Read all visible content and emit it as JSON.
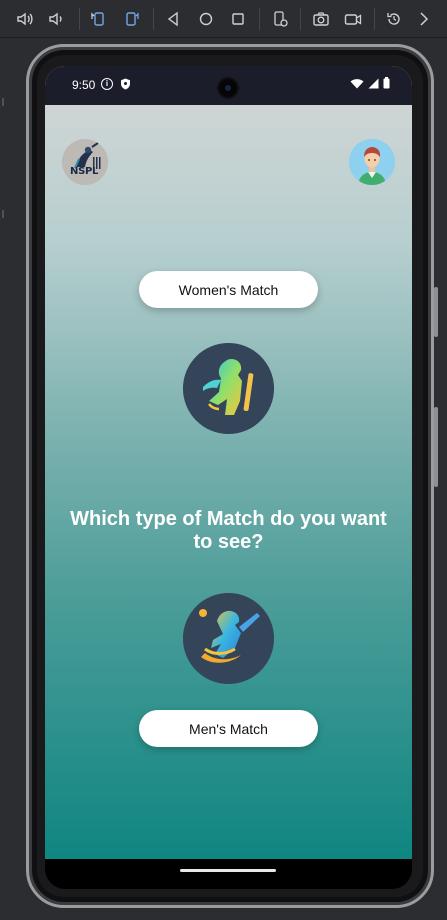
{
  "status_bar": {
    "time": "9:50",
    "info_glyph": "i"
  },
  "app": {
    "logo_text": "NSPL",
    "womens_button_label": "Women's Match",
    "question_text": "Which type of Match do you want to see?",
    "mens_button_label": "Men's Match"
  },
  "colors": {
    "gradient_top": "#d6d6d6",
    "gradient_bottom": "#0f8681",
    "emblem_bg": "#34455a",
    "status_bar_bg": "#1c1d2b"
  },
  "icons": {
    "toolbar": [
      "volume-up-icon",
      "volume-down-icon",
      "rotate-left-icon",
      "rotate-right-icon",
      "back-icon",
      "home-icon",
      "overview-icon",
      "device-settings-icon",
      "screenshot-icon",
      "screen-record-icon",
      "snapshot-restore-icon",
      "more-chevron-icon"
    ],
    "status": [
      "info-icon",
      "shield-icon",
      "wifi-icon",
      "signal-icon",
      "battery-icon"
    ],
    "app": [
      "nspl-logo",
      "user-avatar",
      "women-cricketer-emblem",
      "men-cricketer-emblem"
    ]
  }
}
